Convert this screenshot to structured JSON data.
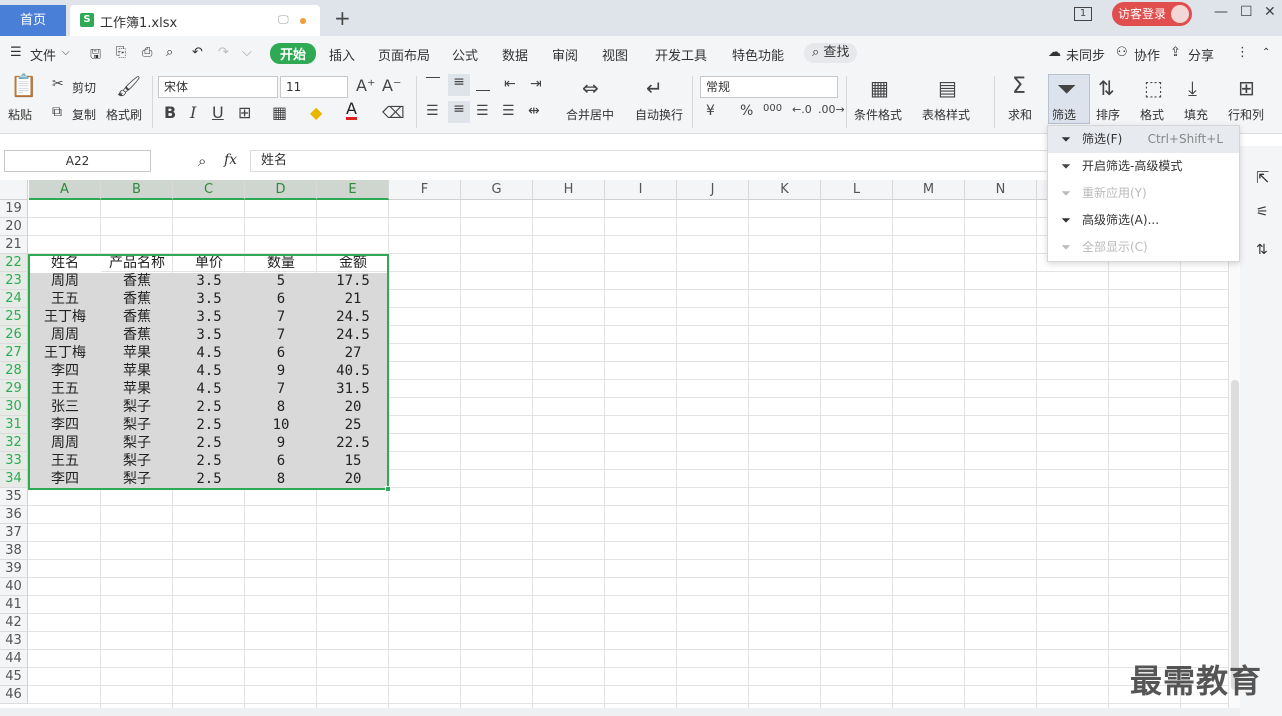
{
  "tabs": {
    "home": "首页",
    "doc": "工作簿1.xlsx",
    "new_tab": "+"
  },
  "window": {
    "page_badge": "1",
    "login": "访客登录",
    "minimize": "—",
    "maximize": "☐",
    "close": "✕"
  },
  "menu": {
    "file": "文件",
    "items": [
      "开始",
      "插入",
      "页面布局",
      "公式",
      "数据",
      "审阅",
      "视图",
      "开发工具",
      "特色功能"
    ],
    "search": "查找",
    "sync": "未同步",
    "collab": "协作",
    "share": "分享"
  },
  "ribbon": {
    "paste": "粘贴",
    "cut": "剪切",
    "copy": "复制",
    "format_painter": "格式刷",
    "font": "宋体",
    "size": "11",
    "bold": "B",
    "italic": "I",
    "underline": "U",
    "merge": "合并居中",
    "wrap": "自动换行",
    "num_format": "常规",
    "currency": "¥",
    "percent": "%",
    "thousands": "000",
    "cond_format": "条件格式",
    "table_style": "表格样式",
    "sum": "求和",
    "filter": "筛选",
    "sort": "排序",
    "format": "格式",
    "fill": "填充",
    "rowcol": "行和列"
  },
  "formula": {
    "cell_ref": "A22",
    "fx": "fx",
    "value": "姓名"
  },
  "columns": [
    "A",
    "B",
    "C",
    "D",
    "E",
    "F",
    "G",
    "H",
    "I",
    "J",
    "K",
    "L",
    "M",
    "N"
  ],
  "rows": [
    "19",
    "20",
    "21",
    "22",
    "23",
    "24",
    "25",
    "26",
    "27",
    "28",
    "29",
    "30",
    "31",
    "32",
    "33",
    "34",
    "35",
    "36",
    "37",
    "38",
    "39",
    "40",
    "41",
    "42",
    "43",
    "44",
    "45",
    "46"
  ],
  "table": {
    "header": [
      "姓名",
      "产品名称",
      "单价",
      "数量",
      "金额"
    ],
    "rows": [
      [
        "周周",
        "香蕉",
        "3.5",
        "5",
        "17.5"
      ],
      [
        "王五",
        "香蕉",
        "3.5",
        "6",
        "21"
      ],
      [
        "王丁梅",
        "香蕉",
        "3.5",
        "7",
        "24.5"
      ],
      [
        "周周",
        "香蕉",
        "3.5",
        "7",
        "24.5"
      ],
      [
        "王丁梅",
        "苹果",
        "4.5",
        "6",
        "27"
      ],
      [
        "李四",
        "苹果",
        "4.5",
        "9",
        "40.5"
      ],
      [
        "王五",
        "苹果",
        "4.5",
        "7",
        "31.5"
      ],
      [
        "张三",
        "梨子",
        "2.5",
        "8",
        "20"
      ],
      [
        "李四",
        "梨子",
        "2.5",
        "10",
        "25"
      ],
      [
        "周周",
        "梨子",
        "2.5",
        "9",
        "22.5"
      ],
      [
        "王五",
        "梨子",
        "2.5",
        "6",
        "15"
      ],
      [
        "李四",
        "梨子",
        "2.5",
        "8",
        "20"
      ]
    ]
  },
  "dropdown": [
    {
      "label": "筛选(F)",
      "shortcut": "Ctrl+Shift+L",
      "icon": "funnel-icon",
      "disabled": false
    },
    {
      "label": "开启筛选-高级模式",
      "shortcut": "",
      "icon": "funnel-advanced-icon",
      "disabled": false
    },
    {
      "label": "重新应用(Y)",
      "shortcut": "",
      "icon": "funnel-reapply-icon",
      "disabled": true
    },
    {
      "label": "高级筛选(A)...",
      "shortcut": "",
      "icon": "funnel-list-icon",
      "disabled": false
    },
    {
      "label": "全部显示(C)",
      "shortcut": "",
      "icon": "funnel-clear-icon",
      "disabled": true
    }
  ],
  "watermark": "最需教育",
  "colors": {
    "accent": "#2eaa55",
    "home_tab": "#4a7fd8",
    "login": "#e04e4e"
  }
}
